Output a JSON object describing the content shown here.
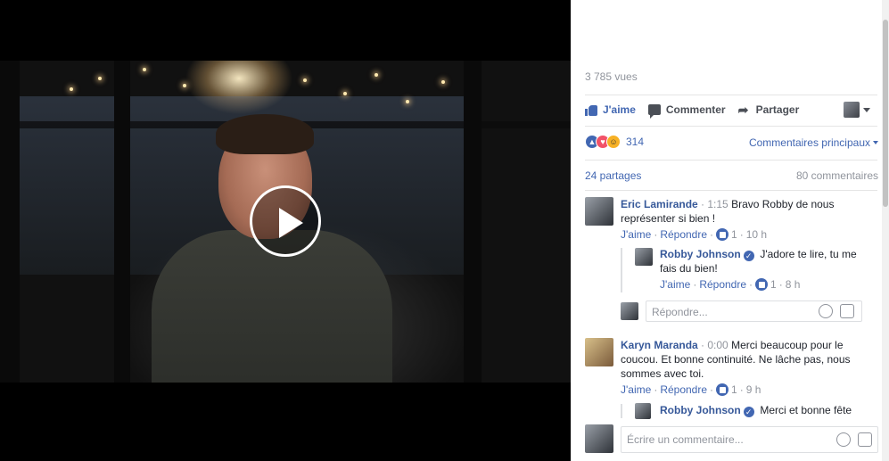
{
  "video": {
    "play_label": "Play"
  },
  "panel": {
    "views": "3 785 vues",
    "actions": {
      "like": "J'aime",
      "comment": "Commenter",
      "share": "Partager"
    },
    "reactions": {
      "count": "314",
      "sort_label": "Commentaires principaux"
    },
    "shares": "24 partages",
    "comments_total": "80 commentaires",
    "comments": [
      {
        "author": "Eric Lamirande",
        "timestamp_ref": "· 1:15",
        "text_line1": "Bravo Robby de nous",
        "text_line2": "représenter si bien !",
        "like_label": "J'aime",
        "reply_label": "Répondre",
        "likes": "1",
        "age": "10 h",
        "reply": {
          "author": "Robby Johnson",
          "text_line1": "J'adore te lire, tu me",
          "text_line2": "fais du bien!",
          "like_label": "J'aime",
          "reply_label": "Répondre",
          "likes": "1",
          "age": "8 h"
        },
        "reply_placeholder": "Répondre..."
      },
      {
        "author": "Karyn Maranda",
        "timestamp_ref": "· 0:00",
        "text_line1": "Merci beaucoup pour le",
        "text_line2": "coucou. Et bonne continuité. Ne lâche pas, nous",
        "text_line3": "sommes avec toi.",
        "like_label": "J'aime",
        "reply_label": "Répondre",
        "likes": "1",
        "age": "9 h",
        "reply": {
          "author": "Robby Johnson",
          "text_line1": "Merci et bonne fête"
        }
      }
    ],
    "comment_placeholder": "Écrire un commentaire..."
  }
}
